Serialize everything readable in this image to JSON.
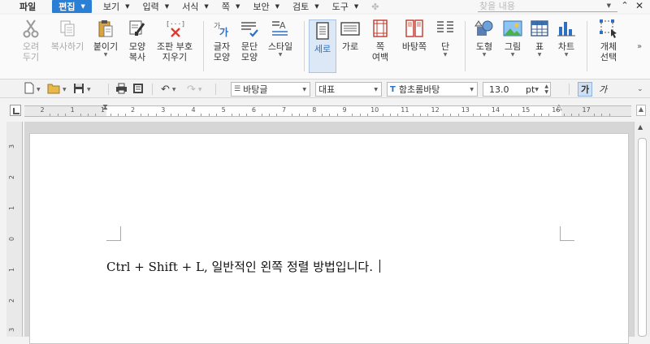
{
  "menu": {
    "file": "파일",
    "edit": "편집",
    "view": "보기",
    "insert": "입력",
    "format": "서식",
    "page": "쪽",
    "security": "보안",
    "review": "검토",
    "tools": "도구",
    "search_placeholder": "찾을 내용"
  },
  "ribbon": {
    "cut": "오려\n두기",
    "copy": "복사하기",
    "paste": "붙이기",
    "format_copy": "모양\n복사",
    "remove_marks": "조판 부호\n지우기",
    "char_shape": "글자\n모양",
    "para_shape": "문단\n모양",
    "style": "스타일",
    "portrait": "세로",
    "landscape": "가로",
    "page_margin": "쪽\n여백",
    "page_border": "바탕쪽",
    "columns": "단",
    "shapes": "도형",
    "picture": "그림",
    "table": "표",
    "chart": "차트",
    "select_object": "개체\n선택"
  },
  "toolbar": {
    "style_value": "바탕글",
    "font_lang": "대표",
    "font_value": "함초롬바탕",
    "font_size": "13.0",
    "font_unit": "pt",
    "bold_char": "가",
    "italic_char": "가"
  },
  "ruler": {
    "numbers": [
      "2",
      "1",
      "1",
      "2",
      "3",
      "4",
      "5",
      "6",
      "7",
      "8",
      "9",
      "10",
      "11",
      "12",
      "13",
      "14",
      "15",
      "16",
      "17"
    ]
  },
  "document": {
    "text": "Ctrl + Shift + L, 일반적인 왼쪽 정렬 방법입니다."
  }
}
